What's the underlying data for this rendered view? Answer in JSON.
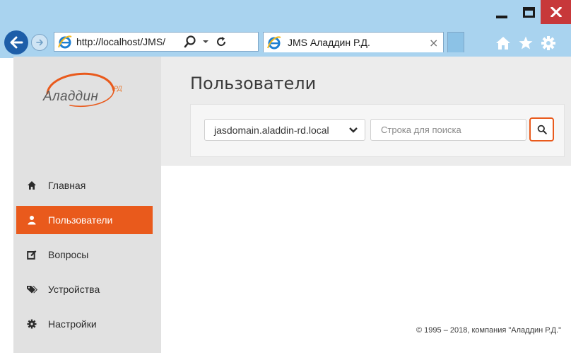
{
  "browser": {
    "url": "http://localhost/JMS/",
    "tab_title": "JMS Аладдин Р.Д.",
    "tab_close": "×"
  },
  "app": {
    "logo_text": "Аладдин",
    "logo_sup": "РД"
  },
  "sidebar": {
    "items": [
      {
        "label": "Главная",
        "icon": "home-icon",
        "active": false
      },
      {
        "label": "Пользователи",
        "icon": "user-icon",
        "active": true
      },
      {
        "label": "Вопросы",
        "icon": "edit-icon",
        "active": false
      },
      {
        "label": "Устройства",
        "icon": "tags-icon",
        "active": false
      },
      {
        "label": "Настройки",
        "icon": "gear-icon",
        "active": false
      }
    ]
  },
  "main": {
    "title": "Пользователи",
    "domain_select": {
      "value": "jasdomain.aladdin-rd.local"
    },
    "search": {
      "placeholder": "Строка для поиска",
      "value": ""
    }
  },
  "footer": {
    "text": "© 1995 – 2018, компания \"Аладдин Р.Д.\""
  },
  "colors": {
    "accent": "#e95a1c",
    "sidebar_bg": "#e1e1e1",
    "header_bg": "#ececec",
    "browser_frame": "#a9d3ef",
    "close_button": "#c7383a"
  }
}
